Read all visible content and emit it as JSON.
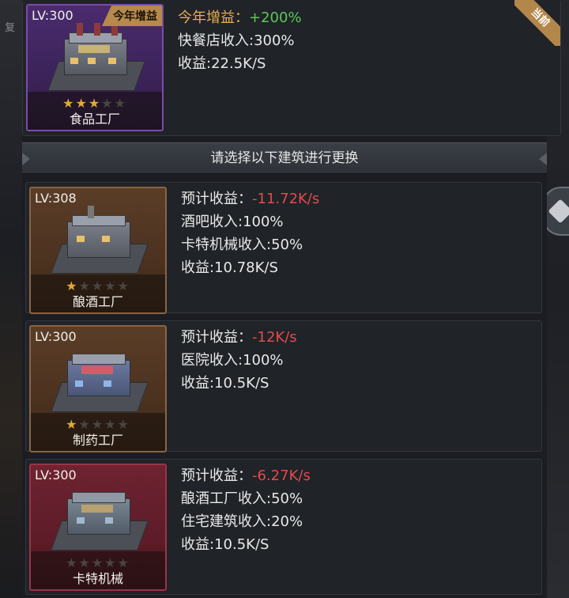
{
  "bg": {
    "left_label": "复"
  },
  "current": {
    "lv": "LV:300",
    "tag": "今年增益",
    "stars_on": 3,
    "stars_total": 5,
    "name": "食品工厂",
    "ribbon": "当前",
    "lines": [
      {
        "label": "今年增益：",
        "value": "+200%"
      },
      {
        "label": "快餐店收入:300%"
      },
      {
        "label": "收益:22.5K/S"
      }
    ]
  },
  "divider": "请选择以下建筑进行更换",
  "options": [
    {
      "lv": "LV:308",
      "name": "酿酒工厂",
      "stars_on": 1,
      "stars_total": 5,
      "forecast_label": "预计收益：",
      "forecast_value": "-11.72K/s",
      "lines": [
        "酒吧收入:100%",
        "卡特机械收入:50%",
        "收益:10.78K/S"
      ]
    },
    {
      "lv": "LV:300",
      "name": "制药工厂",
      "stars_on": 1,
      "stars_total": 5,
      "forecast_label": "预计收益：",
      "forecast_value": "-12K/s",
      "lines": [
        "医院收入:100%",
        "收益:10.5K/S"
      ]
    },
    {
      "lv": "LV:300",
      "name": "卡特机械",
      "stars_on": 0,
      "stars_total": 5,
      "forecast_label": "预计收益：",
      "forecast_value": "-6.27K/s",
      "lines": [
        "酿酒工厂收入:50%",
        "住宅建筑收入:20%",
        "收益:10.5K/S"
      ]
    }
  ],
  "colors": {
    "gold": "#e7ab52",
    "green": "#5fc65a",
    "red": "#e34b4b",
    "star": "#e0a93a"
  }
}
